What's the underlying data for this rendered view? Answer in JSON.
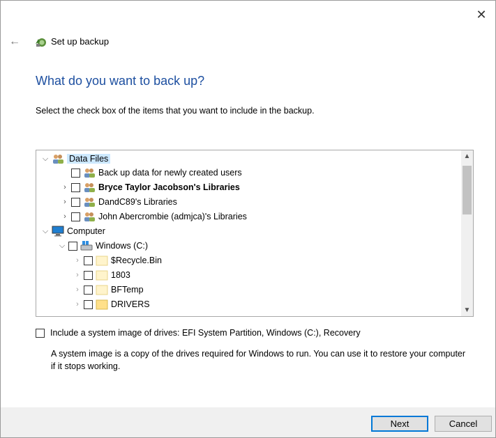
{
  "window": {
    "title": "Set up backup",
    "close_glyph": "✕",
    "back_glyph": "←"
  },
  "page": {
    "heading": "What do you want to back up?",
    "instructions": "Select the check box of the items that you want to include in the backup."
  },
  "tree": {
    "items": [
      {
        "label": "Data Files",
        "expander": "⌵",
        "icon": "users-icon",
        "checkbox": false,
        "bold": false
      },
      {
        "label": "Back up data for newly created users",
        "expander": "",
        "icon": "users-icon",
        "checkbox": true,
        "bold": false
      },
      {
        "label": "Bryce Taylor Jacobson's Libraries",
        "expander": "›",
        "icon": "users-icon",
        "checkbox": true,
        "bold": true
      },
      {
        "label": "DandC89's Libraries",
        "expander": "›",
        "icon": "users-icon",
        "checkbox": true,
        "bold": false
      },
      {
        "label": "John Abercrombie (admjca)'s Libraries",
        "expander": "›",
        "icon": "users-icon",
        "checkbox": true,
        "bold": false
      },
      {
        "label": "Computer",
        "expander": "⌵",
        "icon": "computer-icon",
        "checkbox": false,
        "bold": false
      },
      {
        "label": "Windows (C:)",
        "expander": "⌵",
        "icon": "drive-icon",
        "checkbox": true,
        "bold": false
      },
      {
        "label": "$Recycle.Bin",
        "expander": "›",
        "icon": "folder-icon",
        "checkbox": true,
        "bold": false
      },
      {
        "label": "1803",
        "expander": "›",
        "icon": "folder-icon",
        "checkbox": true,
        "bold": false
      },
      {
        "label": "BFTemp",
        "expander": "›",
        "icon": "folder-icon",
        "checkbox": true,
        "bold": false
      },
      {
        "label": "DRIVERS",
        "expander": "›",
        "icon": "folder-icon",
        "checkbox": true,
        "bold": false
      }
    ],
    "scroll_up_glyph": "▲",
    "scroll_down_glyph": "▼"
  },
  "system_image": {
    "label": "Include a system image of drives: EFI System Partition, Windows (C:), Recovery",
    "checked": false,
    "description": "A system image is a copy of the drives required for Windows to run. You can use it to restore your computer if it stops working."
  },
  "buttons": {
    "next": "Next",
    "cancel": "Cancel"
  },
  "colors": {
    "heading": "#1d4fa0",
    "selection": "#cce8ff",
    "focus_border": "#0078d7"
  }
}
